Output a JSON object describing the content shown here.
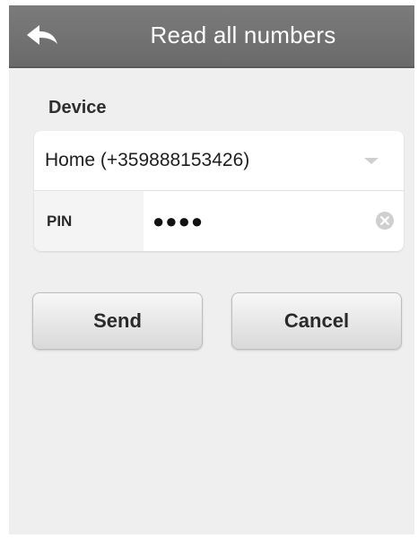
{
  "header": {
    "title": "Read all numbers",
    "back_icon": "back-arrow-icon"
  },
  "form": {
    "device_label": "Device",
    "device_value": "Home (+359888153426)",
    "pin_label": "PIN",
    "pin_value": "●●●●",
    "clear_icon": "clear-circle-icon",
    "dropdown_icon": "chevron-down-icon"
  },
  "buttons": {
    "send_label": "Send",
    "cancel_label": "Cancel"
  },
  "colors": {
    "header_bg": "#6f6f6f",
    "page_bg": "#efefef",
    "card_bg": "#ffffff",
    "text": "#2a2a2a"
  }
}
